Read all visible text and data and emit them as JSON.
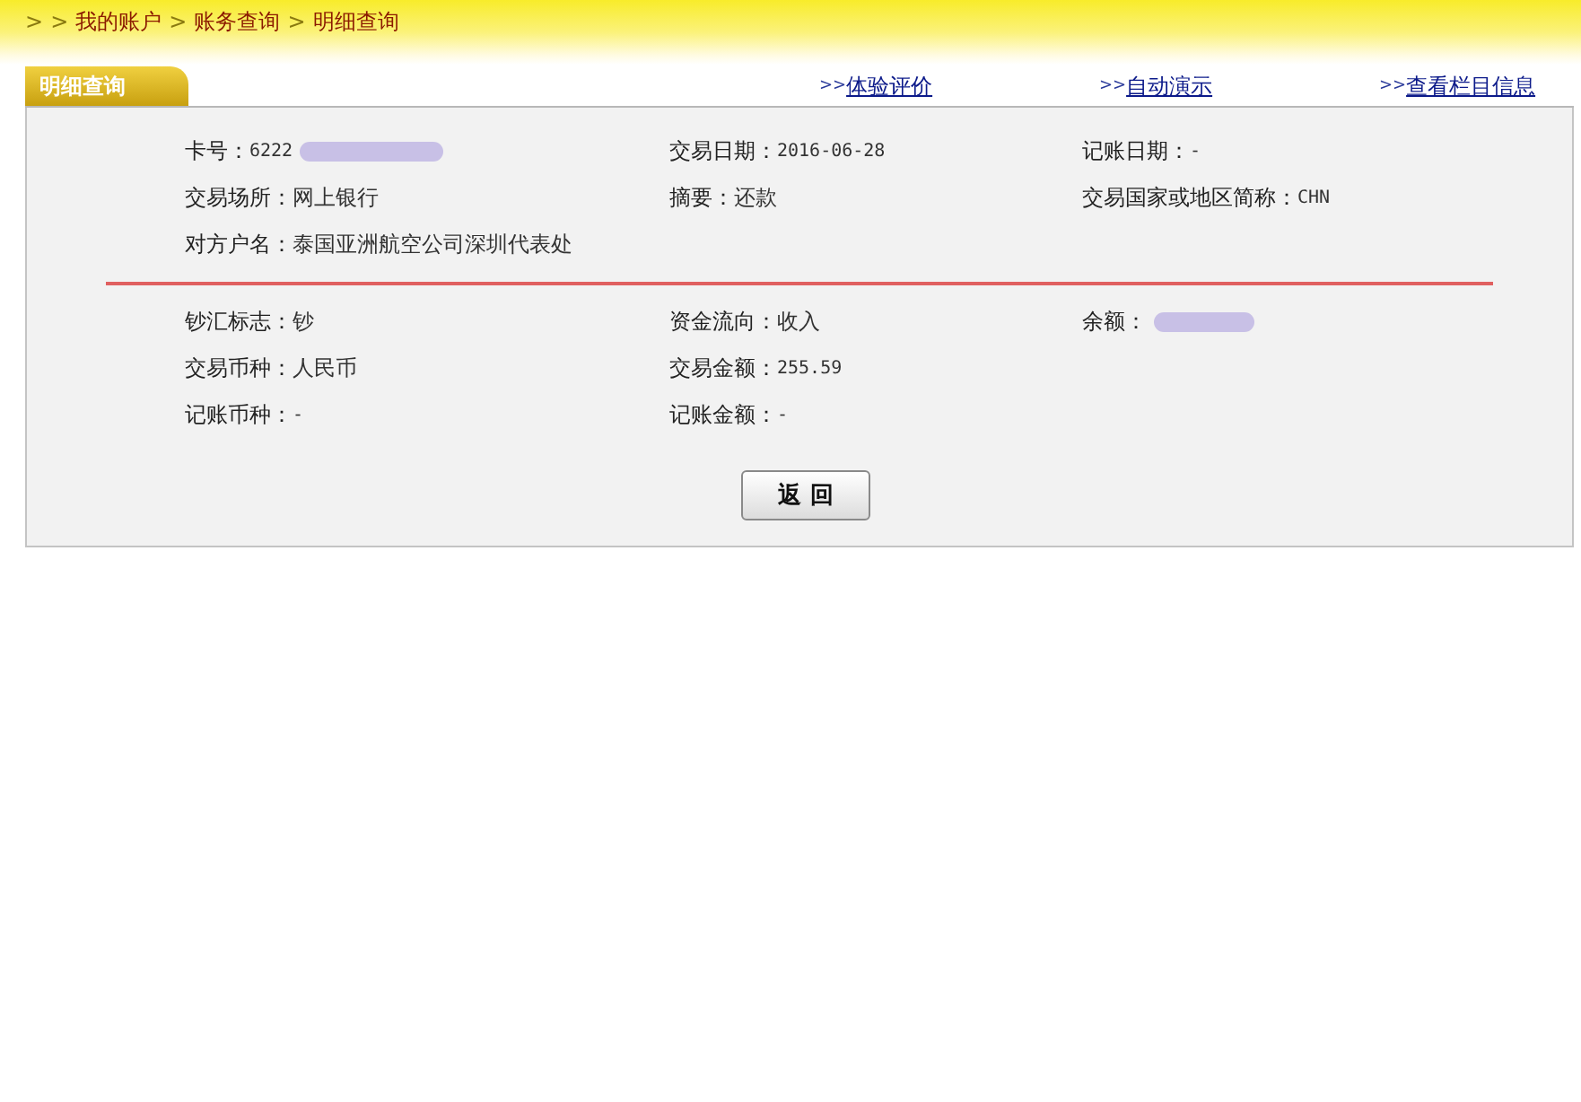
{
  "breadcrumb": [
    ">",
    ">",
    "我的账户",
    ">",
    "账务查询",
    ">",
    "明细查询"
  ],
  "tab": {
    "label": "明细查询",
    "selected": true
  },
  "links": [
    {
      "prefix": ">>",
      "label": "体验评价"
    },
    {
      "prefix": ">>",
      "label": "自动演示"
    },
    {
      "prefix": ">>",
      "label": "查看栏目信息"
    }
  ],
  "sections": [
    {
      "rows": [
        [
          {
            "label": "卡号：",
            "value": "6222",
            "redacted": true
          },
          {
            "label": "交易日期：",
            "value": "2016-06-28",
            "redacted": false
          },
          {
            "label": "记账日期：",
            "value": "-",
            "redacted": false
          }
        ],
        [
          {
            "label": "交易场所：",
            "value": "网上银行",
            "redacted": false
          },
          {
            "label": "摘要：",
            "value": "还款",
            "redacted": false
          },
          {
            "label": "交易国家或地区简称：",
            "value": "CHN",
            "redacted": false
          }
        ],
        [
          {
            "label": "对方户名：",
            "value": "泰国亚洲航空公司深圳代表处",
            "redacted": false
          }
        ]
      ]
    },
    {
      "rows": [
        [
          {
            "label": "钞汇标志：",
            "value": "钞",
            "redacted": false
          },
          {
            "label": "资金流向：",
            "value": "收入",
            "redacted": false
          },
          {
            "label": "余额：",
            "redacted": true
          }
        ],
        [
          {
            "label": "交易币种：",
            "value": "人民币",
            "redacted": false
          },
          {
            "label": "交易金额：",
            "value": "255.59",
            "redacted": false
          }
        ],
        [
          {
            "label": "记账币种：",
            "value": "-",
            "redacted": false
          },
          {
            "label": "记账金额：",
            "value": "-",
            "redacted": false
          }
        ]
      ]
    }
  ],
  "button": "返 回"
}
